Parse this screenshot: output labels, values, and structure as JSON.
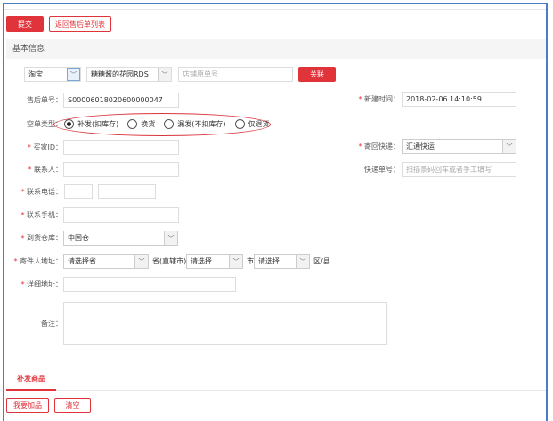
{
  "toolbar": {
    "submit": "提交",
    "back": "返回售后单列表"
  },
  "section": {
    "title": "基本信息"
  },
  "link_row": {
    "platform": "淘宝",
    "shop": "糖糖酱的花园RDS",
    "order_placeholder": "店铺原单号",
    "link_btn": "关联"
  },
  "form": {
    "after_sale_no": {
      "label": "售后单号：",
      "value": "S00006018020600000047"
    },
    "created_time": {
      "label": "新建时间：",
      "value": "2018-02-06 14:10:59"
    },
    "type": {
      "label": "空单类型：",
      "options": [
        "补发(扣库存)",
        "换货",
        "漏发(不扣库存)",
        "仅退货"
      ],
      "selected": 0
    },
    "buyer_id": {
      "label": "买家ID："
    },
    "return_express": {
      "label": "寄回快递：",
      "value": "汇通快运"
    },
    "contact": {
      "label": "联系人："
    },
    "tracking": {
      "label": "快递单号：",
      "placeholder": "扫描条码回车或者手工填写"
    },
    "phone": {
      "label": "联系电话："
    },
    "mobile": {
      "label": "联系手机："
    },
    "warehouse": {
      "label": "到货仓库：",
      "value": "中国仓"
    },
    "address": {
      "label": "寄件人地址：",
      "province": "请选择省",
      "province_suffix": "省(直辖市)",
      "city": "请选择",
      "city_suffix": "市",
      "district": "请选择",
      "district_suffix": "区/县"
    },
    "detail_address": {
      "label": "详细地址："
    },
    "remark": {
      "label": "备注："
    },
    "required_mark": "*"
  },
  "tab": {
    "label": "补发商品"
  },
  "bottom": {
    "add": "我要加品",
    "clear": "清空"
  }
}
